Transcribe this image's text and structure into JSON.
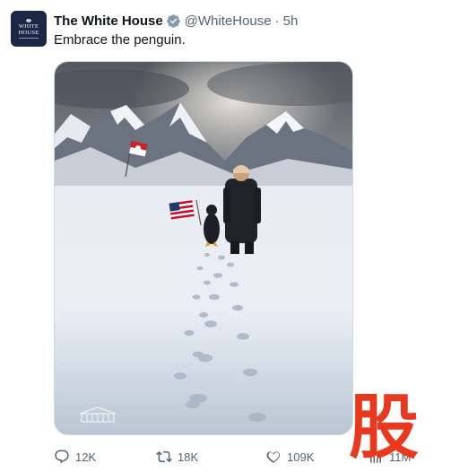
{
  "avatar": {
    "line1": "WHITE",
    "line2": "HOUSE"
  },
  "header": {
    "display_name": "The White House",
    "handle": "@WhiteHouse",
    "separator": "·",
    "time": "5h"
  },
  "tweet": {
    "text": "Embrace the penguin."
  },
  "media": {
    "description_icons": [
      "greenland-flag-icon",
      "us-flag-icon",
      "white-house-logo-icon"
    ]
  },
  "actions": {
    "replies": "12K",
    "reposts": "18K",
    "likes": "109K",
    "views": "11M"
  },
  "overlay": {
    "watermark_char": "股"
  },
  "colors": {
    "verified": "#829aab",
    "text_secondary": "#536471",
    "watermark": "#e8391f"
  }
}
